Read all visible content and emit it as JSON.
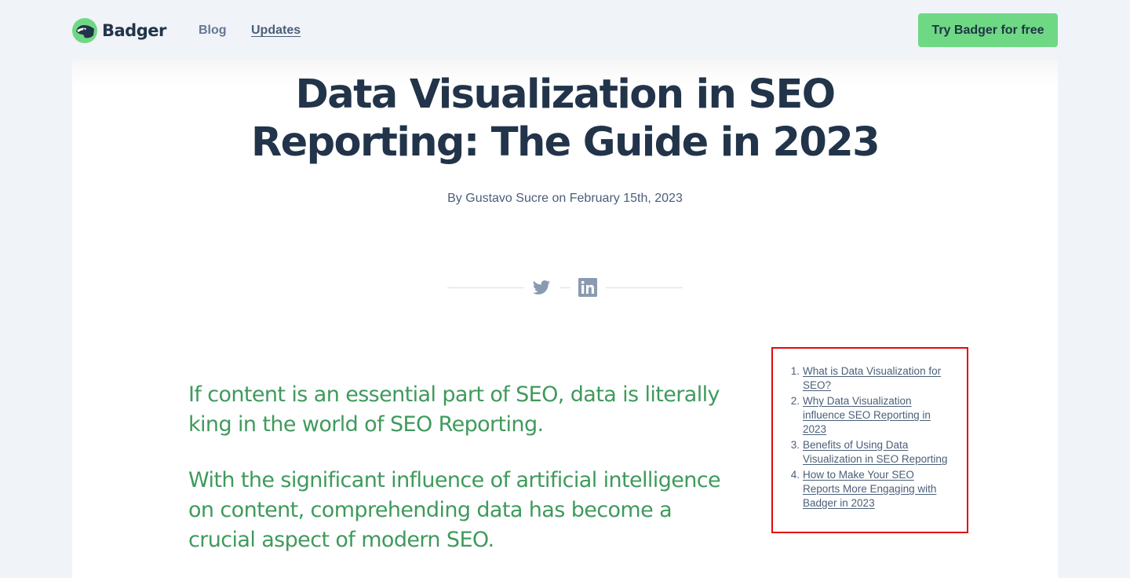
{
  "header": {
    "logo": {
      "text": "Badger",
      "icon": "badger-logo-icon"
    },
    "nav": [
      {
        "label": "Blog",
        "active": false
      },
      {
        "label": "Updates",
        "active": true
      }
    ],
    "cta_label": "Try Badger for free"
  },
  "article": {
    "title_lines": [
      "Data Visualization in SEO",
      "Reporting: The Guide in 2023"
    ],
    "byline": "By Gustavo Sucre on February 15th, 2023",
    "share": [
      {
        "name": "twitter",
        "icon": "twitter-icon"
      },
      {
        "name": "linkedin",
        "icon": "linkedin-icon"
      }
    ],
    "intro": [
      "If content is an essential part of SEO, data is literally king in the world of SEO Reporting.",
      "With the significant influence of artificial intelligence on content, comprehending data has become a crucial aspect of modern SEO."
    ],
    "toc": [
      {
        "num": "1.",
        "label": "What is Data Visualization for SEO?"
      },
      {
        "num": "2.",
        "label": "Why Data Visualization influence SEO Reporting in 2023"
      },
      {
        "num": "3.",
        "label": "Benefits of Using Data Visualization in SEO Reporting"
      },
      {
        "num": "4.",
        "label": "How to Make Your SEO Reports More Engaging with Badger in 2023"
      }
    ]
  },
  "colors": {
    "page_bg": "#f0f3f8",
    "brand_green": "#6fd884",
    "text_dark": "#22344a",
    "intro_green": "#3f9a5c",
    "toc_border": "#e00b0b"
  }
}
